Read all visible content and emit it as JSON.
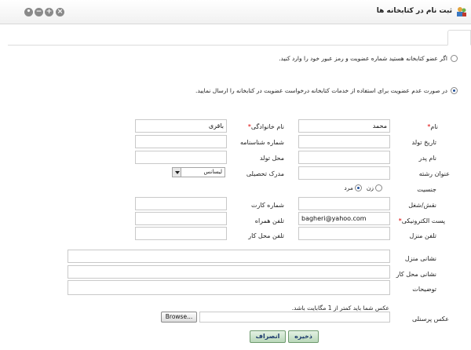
{
  "window": {
    "title": "ثبت نام در کتابخانه ها",
    "controls": [
      "close-icon",
      "add-icon",
      "minimize-icon",
      "options-icon"
    ]
  },
  "membership": {
    "existing_member_text": "اگر عضو کتابخانه هستید شماره عضویت و رمز عبور خود را وارد کنید.",
    "new_member_text": "در صورت عدم عضویت برای استفاده از خدمات کتابخانه درخواست عضویت در کتابخانه را ارسال نمایید.",
    "selected": "new_member"
  },
  "form": {
    "first_name": {
      "label": "نام",
      "value": "محمد",
      "required": true
    },
    "last_name": {
      "label": "نام خانوادگی",
      "value": "باقری",
      "required": true
    },
    "birth_date": {
      "label": "تاریخ تولد",
      "value": ""
    },
    "id_number": {
      "label": "شماره شناسنامه",
      "value": ""
    },
    "father_name": {
      "label": "نام پدر",
      "value": ""
    },
    "birth_place": {
      "label": "محل تولد",
      "value": ""
    },
    "field_of_study": {
      "label": "عنوان رشته",
      "value": ""
    },
    "education": {
      "label": "مدرک تحصیلی",
      "value": "لیسانس"
    },
    "gender": {
      "label": "جنسیت",
      "female": "زن",
      "male": "مرد",
      "selected": "male"
    },
    "role": {
      "label": "نقش/شغل",
      "value": ""
    },
    "card_number": {
      "label": "شماره کارت",
      "value": ""
    },
    "email": {
      "label": "پست الکترونیکی",
      "value": "bagheri@yahoo.com",
      "required": true
    },
    "mobile": {
      "label": "تلفن همراه",
      "value": ""
    },
    "home_phone": {
      "label": "تلفن منزل",
      "value": ""
    },
    "work_phone": {
      "label": "تلفن محل کار",
      "value": ""
    },
    "home_address": {
      "label": "نشانی منزل",
      "value": ""
    },
    "work_address": {
      "label": "نشانی محل کار",
      "value": ""
    },
    "notes": {
      "label": "توضیحات",
      "value": ""
    },
    "photo": {
      "label": "عکس پرسنلی",
      "hint": "عکس شما باید کمتر از 1 مگابایت باشد.",
      "browse_label": "Browse..."
    }
  },
  "actions": {
    "save_label": "ذخیره",
    "cancel_label": "انصراف"
  }
}
